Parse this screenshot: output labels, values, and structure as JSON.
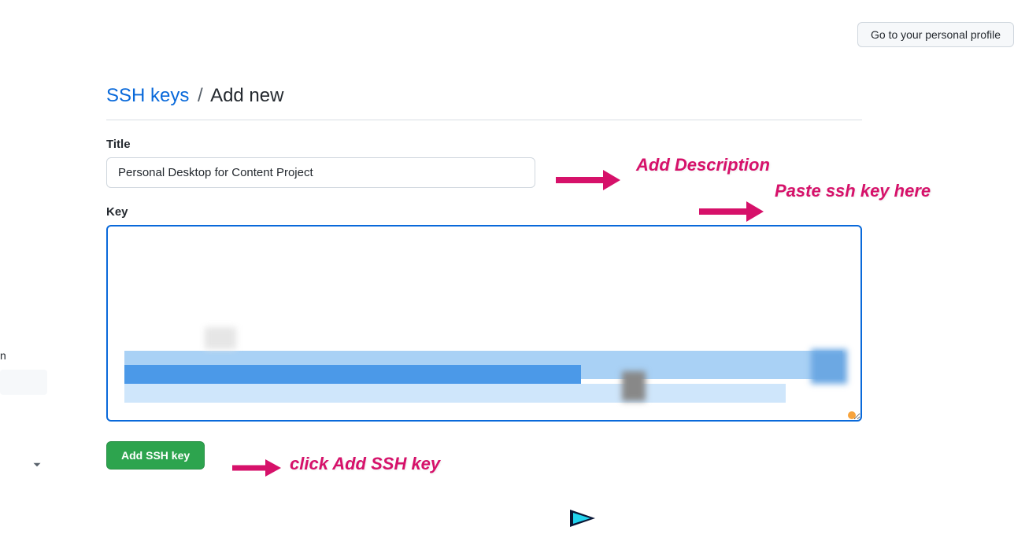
{
  "header": {
    "profile_button": "Go to your personal profile"
  },
  "breadcrumb": {
    "parent": "SSH keys",
    "separator": "/",
    "current": "Add new"
  },
  "form": {
    "title_label": "Title",
    "title_value": "Personal Desktop for Content Project",
    "key_label": "Key",
    "key_value": "",
    "submit_label": "Add SSH key"
  },
  "annotations": {
    "desc": "Add Description",
    "paste": "Paste ssh key here",
    "click": "click Add SSH key"
  },
  "sidebar": {
    "item_text_partial": "n"
  }
}
